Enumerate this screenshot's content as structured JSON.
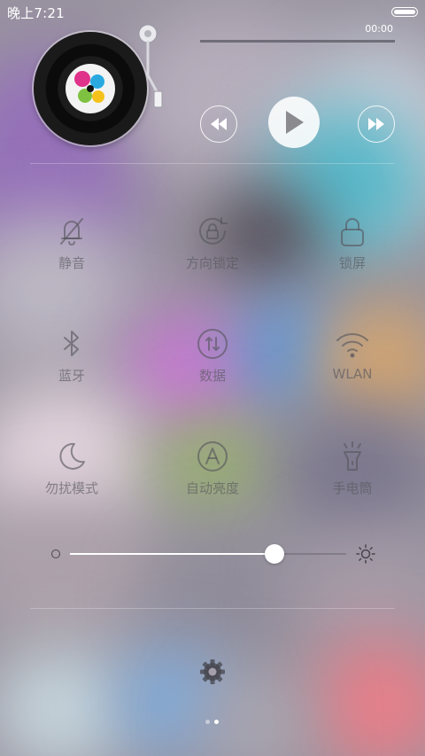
{
  "status_bar": {
    "time": "晚上7:21"
  },
  "music": {
    "elapsed": "00:00",
    "progress": 0
  },
  "toggles": [
    {
      "label": "静音",
      "icon": "bell-muted-icon"
    },
    {
      "label": "方向锁定",
      "icon": "rotation-lock-icon"
    },
    {
      "label": "锁屏",
      "icon": "lock-icon"
    },
    {
      "label": "蓝牙",
      "icon": "bluetooth-icon"
    },
    {
      "label": "数据",
      "icon": "mobile-data-icon"
    },
    {
      "label": "WLAN",
      "icon": "wifi-icon"
    },
    {
      "label": "勿扰模式",
      "icon": "moon-icon"
    },
    {
      "label": "自动亮度",
      "icon": "auto-brightness-icon"
    },
    {
      "label": "手电筒",
      "icon": "flashlight-icon"
    }
  ],
  "brightness": {
    "level": 0.74
  },
  "pager": {
    "pages": 2,
    "current": 1
  },
  "colors": {
    "icon_gray": "#55555c",
    "white": "#ffffff"
  }
}
